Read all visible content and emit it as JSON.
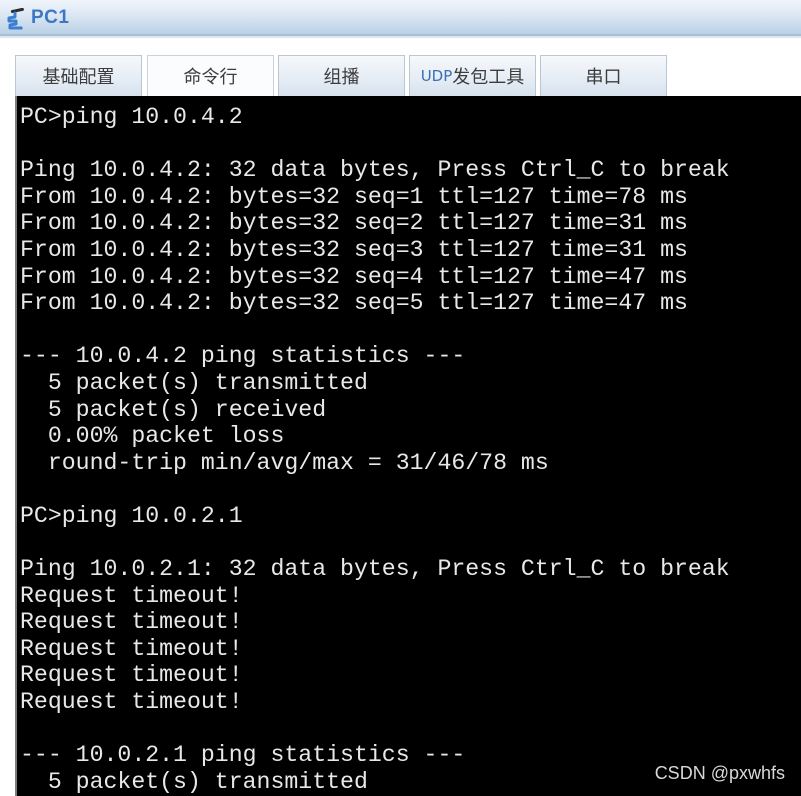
{
  "window": {
    "title": "PC1",
    "icon": "network-pc-icon"
  },
  "tabs": [
    {
      "label": "基础配置",
      "active": false
    },
    {
      "label": "命令行",
      "active": true
    },
    {
      "label": "组播",
      "active": false
    },
    {
      "label_prefix": "UDP",
      "label_suffix": "发包工具",
      "active": false
    },
    {
      "label": "串口",
      "active": false
    }
  ],
  "terminal": {
    "lines": [
      "PC>ping 10.0.4.2",
      "",
      "Ping 10.0.4.2: 32 data bytes, Press Ctrl_C to break",
      "From 10.0.4.2: bytes=32 seq=1 ttl=127 time=78 ms",
      "From 10.0.4.2: bytes=32 seq=2 ttl=127 time=31 ms",
      "From 10.0.4.2: bytes=32 seq=3 ttl=127 time=31 ms",
      "From 10.0.4.2: bytes=32 seq=4 ttl=127 time=47 ms",
      "From 10.0.4.2: bytes=32 seq=5 ttl=127 time=47 ms",
      "",
      "--- 10.0.4.2 ping statistics ---",
      "  5 packet(s) transmitted",
      "  5 packet(s) received",
      "  0.00% packet loss",
      "  round-trip min/avg/max = 31/46/78 ms",
      "",
      "PC>ping 10.0.2.1",
      "",
      "Ping 10.0.2.1: 32 data bytes, Press Ctrl_C to break",
      "Request timeout!",
      "Request timeout!",
      "Request timeout!",
      "Request timeout!",
      "Request timeout!",
      "",
      "--- 10.0.2.1 ping statistics ---",
      "  5 packet(s) transmitted"
    ]
  },
  "watermark": "CSDN @pxwhfs",
  "colors": {
    "title_text": "#3a78c4",
    "terminal_bg": "#000000",
    "terminal_fg": "#e8e8e8"
  }
}
